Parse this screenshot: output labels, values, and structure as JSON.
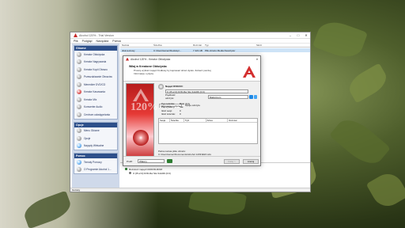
{
  "window": {
    "title": "Alcohol 120% - Trial Version",
    "menus": [
      "Plik",
      "Podgląd",
      "Narzędzia",
      "Pomoc"
    ],
    "controls": [
      "–",
      "□",
      "✕"
    ]
  },
  "sidebar": {
    "sections": [
      {
        "title": "Główne",
        "items": [
          {
            "label": "Kreator Obłożyska",
            "icon": "disc-icon",
            "tone": "grey"
          },
          {
            "label": "Kreator Nagrywania",
            "icon": "burn-disc-icon",
            "tone": "grey"
          },
          {
            "label": "Kreator Kopii Obrazu",
            "icon": "copy-disc-icon",
            "tone": "grey"
          },
          {
            "label": "Przeszukiwanie Obrazów",
            "icon": "search-disc-icon",
            "tone": "grey"
          },
          {
            "label": "Menedżer DVD/CD",
            "icon": "disc-manager-icon",
            "tone": "grey"
          },
          {
            "label": "Kreator Kasowania",
            "icon": "erase-disc-icon",
            "tone": "red"
          },
          {
            "label": "Kreator Mix",
            "icon": "mix-disc-icon",
            "tone": "grey"
          },
          {
            "label": "Konwerter Audio",
            "icon": "audio-convert-icon",
            "tone": "grey"
          },
          {
            "label": "Centrum udostępniania",
            "icon": "share-center-icon",
            "tone": "grey"
          }
        ]
      },
      {
        "title": "Opcje",
        "items": [
          {
            "label": "Menu Główne",
            "icon": "main-menu-icon",
            "tone": "grey"
          },
          {
            "label": "Opcje",
            "icon": "options-icon",
            "tone": "grey"
          },
          {
            "label": "Napędy Wirtualne",
            "icon": "virtual-drives-icon",
            "tone": "ex"
          }
        ]
      },
      {
        "title": "Pomoc",
        "items": [
          {
            "label": "Tematy Pomocy",
            "icon": "help-topics-icon",
            "tone": "ex"
          },
          {
            "label": "O Programie Alcohol 1...",
            "icon": "about-icon",
            "tone": "grey"
          }
        ]
      }
    ]
  },
  "filelist": {
    "columns": [
      "Nazwa",
      "Ścieżka",
      "Rozmiar",
      "Typ",
      "Skrót"
    ],
    "rows": [
      {
        "name": "disk-textowy",
        "path": "C:\\Users\\tamer\\Desktop\\...",
        "size": "7 421 kB",
        "type": "Plik obrazu Media Descriptor",
        "shortcut": ""
      }
    ]
  },
  "devices": {
    "tree": [
      {
        "label": "Rozszerz napęd CD/DVD-ROM",
        "icon": "drive-icon"
      },
      {
        "label": "0: [PL2.0] DVD-Rw SH-S1A0D (0:0)",
        "icon": "disc-icon"
      }
    ]
  },
  "statusbar": {
    "text": "Gotowy"
  },
  "dialog": {
    "title": "Alcohol 120% - Kreator Obłożyska",
    "header_title": "Witaj w Kreatorze Obłożyska",
    "header_desc": "Proszę wybrać napęd źródłowy by kopiować obraz dysku. Zobacz poniżej Informacje o płycie.",
    "banner_text": "120%",
    "drive_label": "Napęd DVD/CD:",
    "drive_value": "0: [PL2.0] DVD-Rw SH-S1A0D (0:0)",
    "speed_label": "Prędkość odczytu:",
    "speed_value": "Maksimum",
    "tabs": [
      {
        "label": "Informacje o płycie",
        "active": true
      },
      {
        "label": "Opcje odczytu",
        "active": false
      }
    ],
    "info": [
      {
        "label": "Typ nośnika:",
        "value": "Brak płyty"
      },
      {
        "label": "Zapisywalny:",
        "value": "Nie"
      },
      {
        "label": "Ilość sesji:",
        "value": "0"
      },
      {
        "label": "Ilość ścieżek:",
        "value": "0"
      },
      {
        "label": "Rozmiar płyty:",
        "value": ""
      },
      {
        "label": "Ograniczenia:",
        "value": ""
      }
    ],
    "list_columns": [
      "Sesja",
      "Ścieżka",
      "Tryb",
      "Adres",
      "Rozmiar"
    ],
    "path_label": "Pełna nazwa pliku obrazu:",
    "path_value": "C:\\Users\\tamer\\Documents\\Alcohol 120\\NEW.mds",
    "footer": {
      "profile_label": "Profil:",
      "profile_value": "Własny",
      "buttons": [
        "Dalej >",
        "Anuluj"
      ]
    }
  },
  "colors": {
    "sidebar_header": "#2d4f8a",
    "sidebar_bg": "#cfd9ea",
    "brand_red": "#c62828"
  }
}
